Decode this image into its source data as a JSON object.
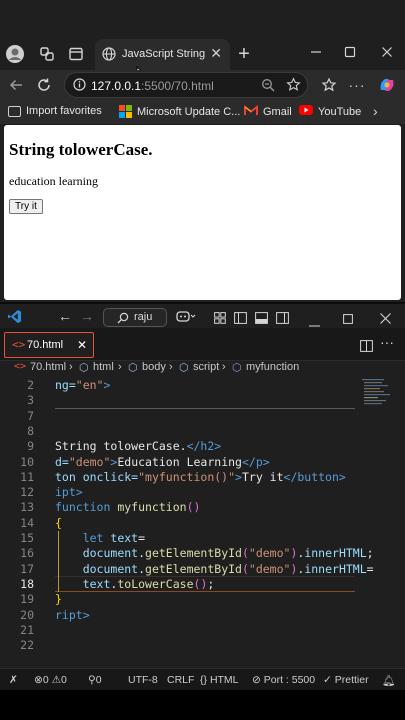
{
  "browser": {
    "active_tab_title": "JavaScript String M",
    "url_host": "127.0.0.1",
    "url_path": ":5500/70.html",
    "bookmarks": [
      {
        "label": "Import favorites",
        "color": "#8a8a8a"
      },
      {
        "label": "Microsoft Update C...",
        "color": "#f25022"
      },
      {
        "label": "Gmail",
        "color": "#ea4335"
      },
      {
        "label": "YouTube",
        "color": "#ff0000"
      }
    ]
  },
  "page": {
    "heading": "String tolowerCase.",
    "paragraph": "education learning",
    "button": "Try it"
  },
  "vscode": {
    "command_center": "raju",
    "file_tab": "70.html",
    "breadcrumb": [
      "70.html",
      "html",
      "body",
      "script",
      "myfunction"
    ],
    "active_line": "18",
    "lines": [
      {
        "n": "2",
        "parts": [
          [
            "attr",
            "ng="
          ],
          [
            "str",
            "\"en\""
          ],
          [
            "tag",
            ">"
          ]
        ]
      },
      {
        "n": "3",
        "parts": []
      },
      {
        "n": "7",
        "parts": []
      },
      {
        "n": "8",
        "parts": []
      },
      {
        "n": "9",
        "parts": [
          [
            "txt",
            "String tolowerCase."
          ],
          [
            "tag",
            "</h2>"
          ]
        ]
      },
      {
        "n": "10",
        "parts": [
          [
            "attr",
            "d="
          ],
          [
            "str",
            "\"demo\""
          ],
          [
            "tag",
            ">"
          ],
          [
            "txt",
            "Education Learning"
          ],
          [
            "tag",
            "</p>"
          ]
        ]
      },
      {
        "n": "11",
        "parts": [
          [
            "attr",
            "ton onclick="
          ],
          [
            "str",
            "\"myfunction()\""
          ],
          [
            "tag",
            ">"
          ],
          [
            "txt",
            "Try it"
          ],
          [
            "tag",
            "</button>"
          ]
        ]
      },
      {
        "n": "12",
        "parts": [
          [
            "tag",
            "ipt>"
          ]
        ]
      },
      {
        "n": "13",
        "parts": [
          [
            "kw",
            "function "
          ],
          [
            "fn",
            "myfunction"
          ],
          [
            "paren",
            "()"
          ]
        ]
      },
      {
        "n": "14",
        "parts": [
          [
            "brace",
            "{"
          ]
        ]
      },
      {
        "n": "15",
        "parts": [
          [
            "txt",
            "    "
          ],
          [
            "kw",
            "let "
          ],
          [
            "var",
            "text"
          ],
          [
            "txt",
            "="
          ]
        ]
      },
      {
        "n": "16",
        "parts": [
          [
            "txt",
            "    "
          ],
          [
            "var",
            "document"
          ],
          [
            "txt",
            "."
          ],
          [
            "fn",
            "getElementById"
          ],
          [
            "paren",
            "("
          ],
          [
            "str",
            "\"demo\""
          ],
          [
            "paren",
            ")"
          ],
          [
            "txt",
            "."
          ],
          [
            "var",
            "innerHTML"
          ],
          [
            "txt",
            ";"
          ]
        ]
      },
      {
        "n": "17",
        "parts": [
          [
            "txt",
            "    "
          ],
          [
            "var",
            "document"
          ],
          [
            "txt",
            "."
          ],
          [
            "fn",
            "getElementById"
          ],
          [
            "paren",
            "("
          ],
          [
            "str",
            "\"demo\""
          ],
          [
            "paren",
            ")"
          ],
          [
            "txt",
            "."
          ],
          [
            "var",
            "innerHTML"
          ],
          [
            "txt",
            "="
          ]
        ]
      },
      {
        "n": "18",
        "parts": [
          [
            "txt",
            "    "
          ],
          [
            "var",
            "text"
          ],
          [
            "txt",
            "."
          ],
          [
            "fn",
            "toLowerCase"
          ],
          [
            "paren",
            "()"
          ],
          [
            "txt",
            ";"
          ]
        ]
      },
      {
        "n": "19",
        "parts": [
          [
            "brace",
            "}"
          ]
        ]
      },
      {
        "n": "20",
        "parts": [
          [
            "tag",
            "ript>"
          ]
        ]
      },
      {
        "n": "21",
        "parts": []
      },
      {
        "n": "22",
        "parts": []
      }
    ],
    "status": {
      "errors": "0",
      "warnings": "0",
      "ports": "0",
      "encoding": "UTF-8",
      "eol": "CRLF",
      "language": "HTML",
      "port": "Port : 5500",
      "prettier": "Prettier"
    }
  }
}
